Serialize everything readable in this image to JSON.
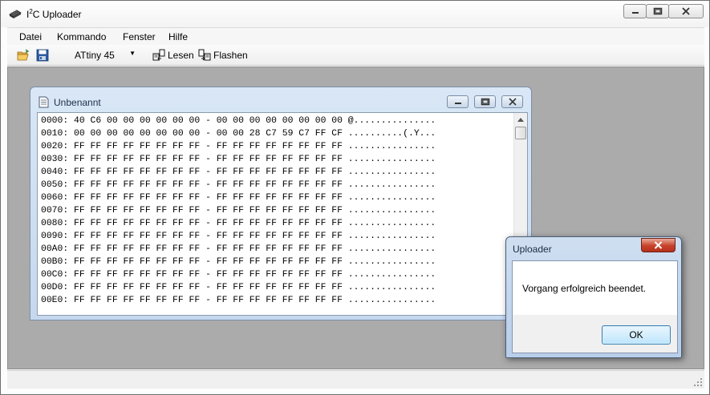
{
  "app": {
    "title_main": "I",
    "title_sup": "2",
    "title_rest": "C Uploader"
  },
  "menu": {
    "items": [
      "Datei",
      "Kommando",
      "Fenster",
      "Hilfe"
    ]
  },
  "toolbar": {
    "open_icon": "folder-open-icon",
    "save_icon": "floppy-disk-icon",
    "device_selected": "ATtiny 45",
    "read_label": "Lesen",
    "flash_label": "Flashen"
  },
  "child": {
    "title": "Unbenannt",
    "hex_lines": [
      "0000: 40 C6 00 00 00 00 00 00 - 00 00 00 00 00 00 00 00 @...............",
      "0010: 00 00 00 00 00 00 00 00 - 00 00 28 C7 59 C7 FF CF ..........(.Y...",
      "0020: FF FF FF FF FF FF FF FF - FF FF FF FF FF FF FF FF ................",
      "0030: FF FF FF FF FF FF FF FF - FF FF FF FF FF FF FF FF ................",
      "0040: FF FF FF FF FF FF FF FF - FF FF FF FF FF FF FF FF ................",
      "0050: FF FF FF FF FF FF FF FF - FF FF FF FF FF FF FF FF ................",
      "0060: FF FF FF FF FF FF FF FF - FF FF FF FF FF FF FF FF ................",
      "0070: FF FF FF FF FF FF FF FF - FF FF FF FF FF FF FF FF ................",
      "0080: FF FF FF FF FF FF FF FF - FF FF FF FF FF FF FF FF ................",
      "0090: FF FF FF FF FF FF FF FF - FF FF FF FF FF FF FF FF ................",
      "00A0: FF FF FF FF FF FF FF FF - FF FF FF FF FF FF FF FF ................",
      "00B0: FF FF FF FF FF FF FF FF - FF FF FF FF FF FF FF FF ................",
      "00C0: FF FF FF FF FF FF FF FF - FF FF FF FF FF FF FF FF ................",
      "00D0: FF FF FF FF FF FF FF FF - FF FF FF FF FF FF FF FF ................",
      "00E0: FF FF FF FF FF FF FF FF - FF FF FF FF FF FF FF FF ................"
    ]
  },
  "dialog": {
    "title": "Uploader",
    "message": "Vorgang erfolgreich beendet.",
    "ok_label": "OK"
  },
  "colors": {
    "mdi_background": "#ababab",
    "dialog_close": "#c7412a",
    "ok_button": "#bee6fd"
  }
}
